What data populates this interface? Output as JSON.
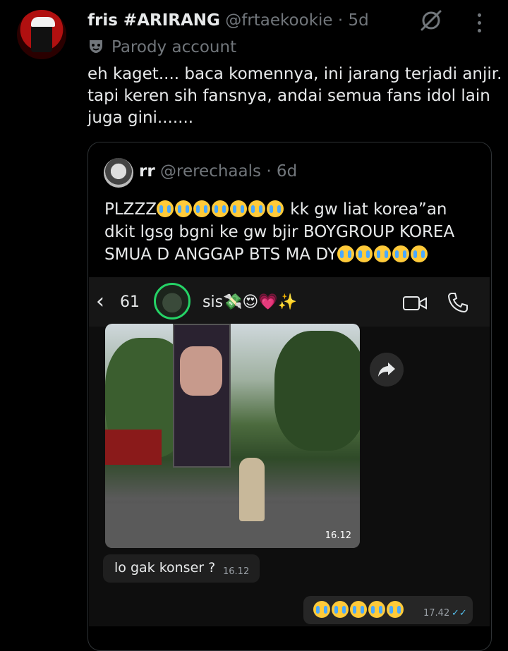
{
  "tweet": {
    "display_name": "fris #ARIRANG",
    "handle": "@frtaekookie",
    "time": "· 5d",
    "label": "Parody account",
    "text_lines": [
      "eh kaget.... baca komennya, ini jarang terjadi anjir.",
      "tapi keren sih fansnya, andai semua fans idol lain",
      "juga gini......."
    ]
  },
  "quote": {
    "display_name": "rr",
    "handle": "@rerechaals",
    "time": "· 6d",
    "text_lines": [
      "PLZZZ",
      " kk gw liat korea”an",
      "dkit lgsg bgni ke gw bjir BOYGROUP KOREA",
      "SMUA D ANGGAP BTS MA DY"
    ]
  },
  "chat": {
    "back_label": "‹",
    "unread_count": "61",
    "contact_name": "sis💸😍💗✨",
    "photo_time": "16.12",
    "incoming_text": "lo gak konser ?",
    "incoming_time": "16.12",
    "outgoing_time": "17.42",
    "read_ticks": "✓✓"
  },
  "icons": {
    "grok": "grok-icon",
    "more": "more-icon",
    "mask": "parody-mask-icon",
    "video": "video-call-icon",
    "phone": "phone-icon",
    "forward": "forward-icon"
  },
  "colors": {
    "background": "#000000",
    "secondary_text": "#71767b",
    "read_ticks": "#53bdeb",
    "story_ring": "#25d366"
  }
}
